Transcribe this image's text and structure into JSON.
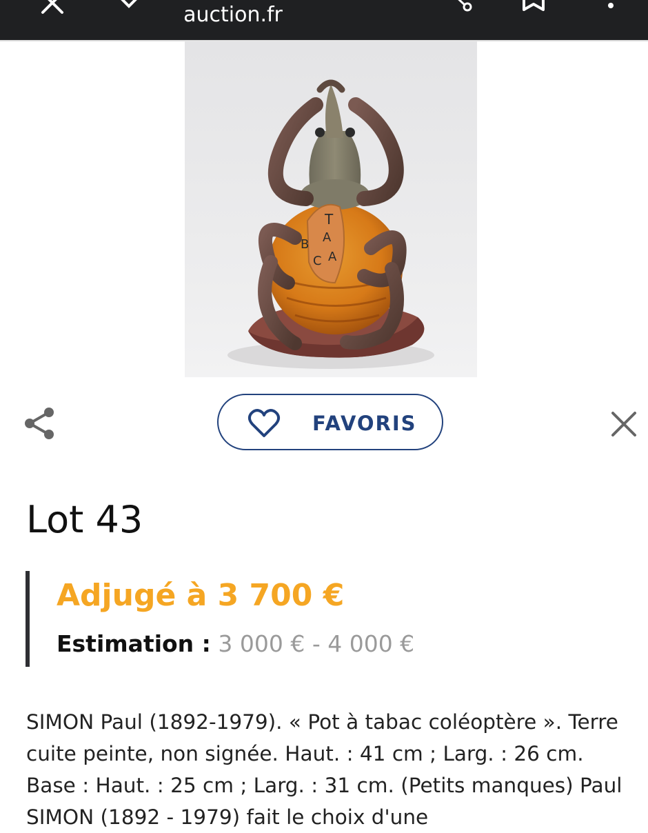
{
  "browser": {
    "url": "auction.fr",
    "icons": [
      "close-icon",
      "chevron-down-icon",
      "share-icon",
      "bookmark-icon",
      "more-vert-icon"
    ]
  },
  "image": {
    "subject": "terracotta beetle tobacco jar",
    "lettering": "TABAC"
  },
  "actions": {
    "favorite_label": "FAVORIS",
    "icons": [
      "share-icon",
      "heart-icon",
      "close-icon"
    ]
  },
  "lot": {
    "title": "Lot 43",
    "sold_text": "Adjugé à 3 700 €",
    "estimate_label": "Estimation :",
    "estimate_value": "3 000 € - 4 000 €",
    "description": "SIMON Paul (1892-1979). « Pot à tabac coléoptère ». Terre cuite peinte, non signée. Haut. : 41 cm ; Larg. : 26 cm. Base : Haut. : 25 cm ; Larg. : 31 cm. (Petits manques) Paul SIMON (1892 - 1979) fait le choix d'une"
  },
  "colors": {
    "topbar": "#1f2022",
    "accent_blue": "#22427d",
    "sold_orange": "#f5a623",
    "estimate_gray": "#9a9a9a"
  }
}
